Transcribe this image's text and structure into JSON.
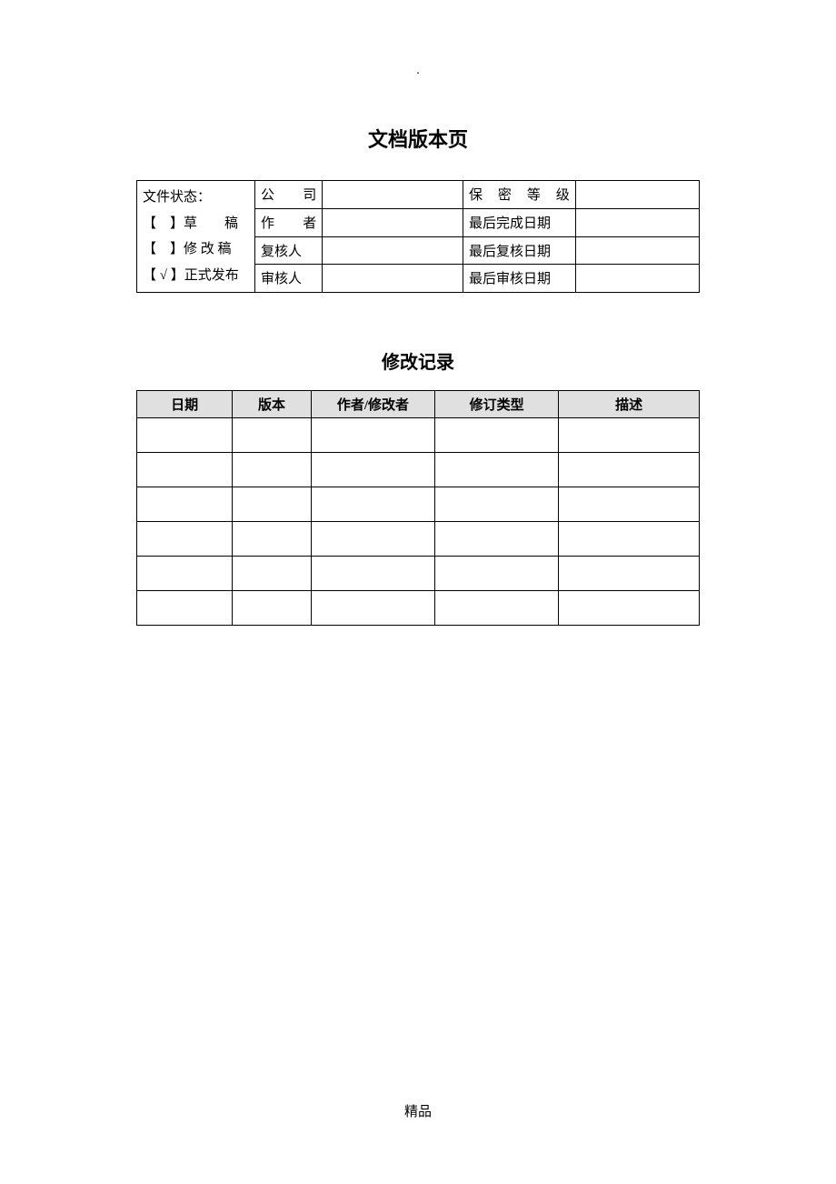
{
  "top_marker": ".",
  "title_version": "文档版本页",
  "version_table": {
    "status": {
      "heading": "文件状态：",
      "option1": "【　】草　　稿",
      "option2": "【　】修 改 稿",
      "option3": "【 √ 】正式发布"
    },
    "rows": [
      {
        "label1": "公　　司",
        "value1": "",
        "label2": "保 密 等 级",
        "value2": ""
      },
      {
        "label1": "作　　者",
        "value1": "",
        "label2": "最后完成日期",
        "value2": ""
      },
      {
        "label1": "复核人",
        "value1": "",
        "label2": "最后复核日期",
        "value2": ""
      },
      {
        "label1": "审核人",
        "value1": "",
        "label2": "最后审核日期",
        "value2": ""
      }
    ]
  },
  "title_revision": "修改记录",
  "revision_table": {
    "headers": [
      "日期",
      "版本",
      "作者/修改者",
      "修订类型",
      "描述"
    ],
    "rows": [
      [
        "",
        "",
        "",
        "",
        ""
      ],
      [
        "",
        "",
        "",
        "",
        ""
      ],
      [
        "",
        "",
        "",
        "",
        ""
      ],
      [
        "",
        "",
        "",
        "",
        ""
      ],
      [
        "",
        "",
        "",
        "",
        ""
      ],
      [
        "",
        "",
        "",
        "",
        ""
      ]
    ]
  },
  "footer": "精品"
}
